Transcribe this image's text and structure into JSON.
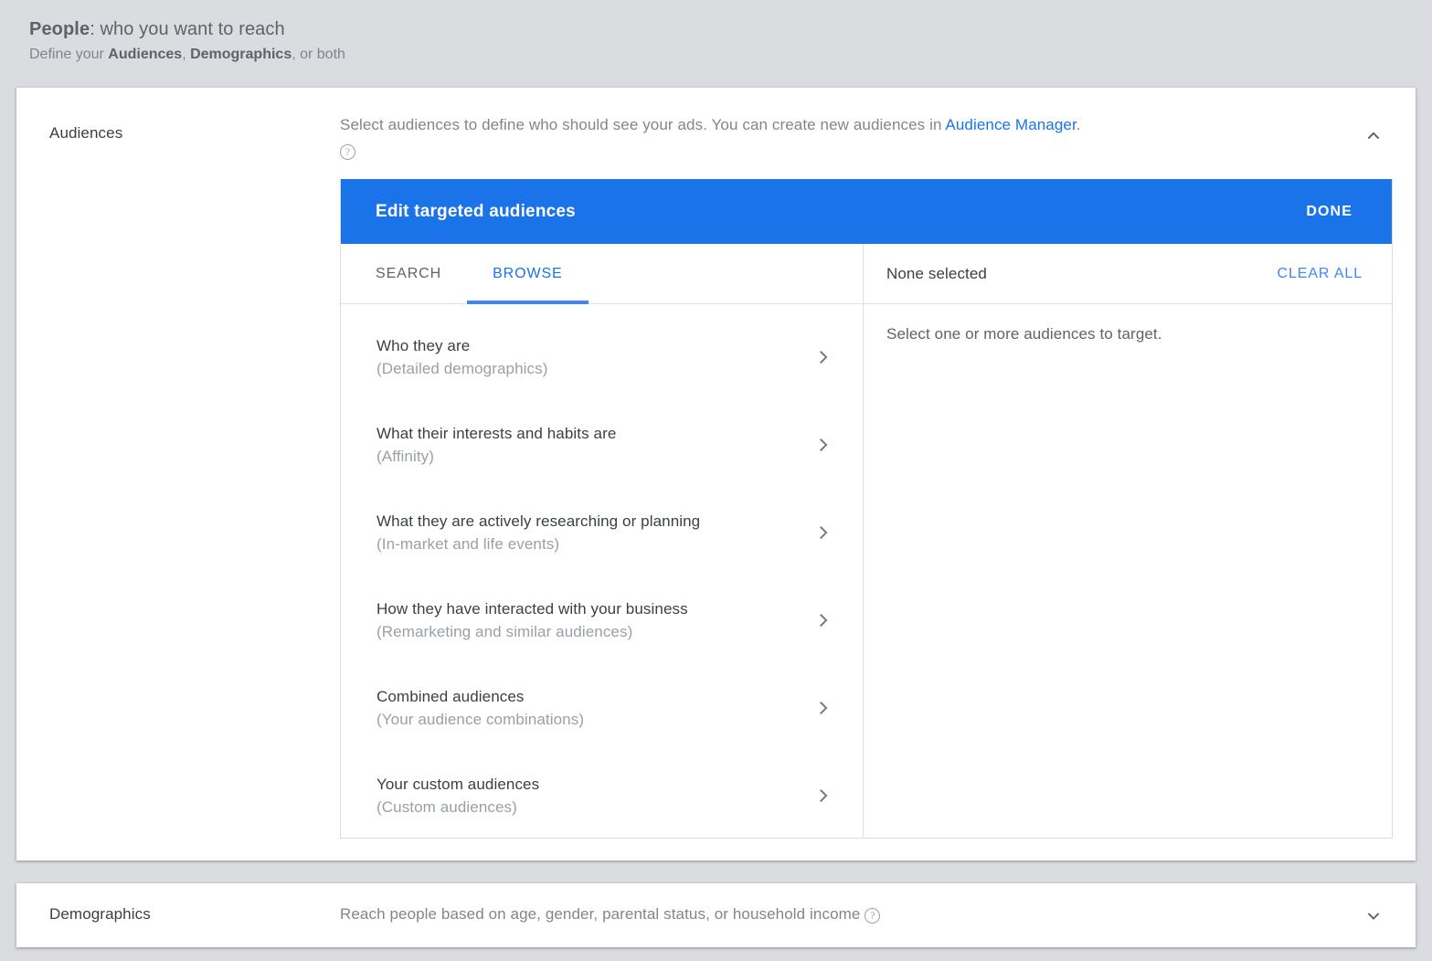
{
  "page": {
    "header": {
      "title_strong": "People",
      "title_rest": ": who you want to reach",
      "sub_lead": "Define your ",
      "sub_b1": "Audiences",
      "sub_mid": ", ",
      "sub_b2": "Demographics",
      "sub_tail": ", or both"
    }
  },
  "audiences": {
    "label": "Audiences",
    "description_pre": "Select audiences to define who should see your ads.  You can create new audiences in ",
    "description_link": "Audience Manager",
    "description_post": ".",
    "help_icon": "help-circle-icon",
    "collapse_icon": "chevron-up-icon",
    "dialog": {
      "title": "Edit targeted audiences",
      "done_label": "DONE",
      "tabs": [
        {
          "label": "SEARCH",
          "active": false
        },
        {
          "label": "BROWSE",
          "active": true
        }
      ],
      "selected_summary": "None selected",
      "clear_all_label": "CLEAR ALL",
      "empty_hint": "Select one or more audiences to target.",
      "browse_items": [
        {
          "title": "Who they are",
          "subtitle": "(Detailed demographics)",
          "arrow_icon": "chevron-right-icon"
        },
        {
          "title": "What their interests and habits are",
          "subtitle": "(Affinity)",
          "arrow_icon": "chevron-right-icon"
        },
        {
          "title": "What they are actively researching or planning",
          "subtitle": "(In-market and life events)",
          "arrow_icon": "chevron-right-icon"
        },
        {
          "title": "How they have interacted with your business",
          "subtitle": "(Remarketing and similar audiences)",
          "arrow_icon": "chevron-right-icon"
        },
        {
          "title": "Combined audiences",
          "subtitle": "(Your audience combinations)",
          "arrow_icon": "chevron-right-icon"
        },
        {
          "title": "Your custom audiences",
          "subtitle": "(Custom audiences)",
          "arrow_icon": "chevron-right-icon"
        }
      ]
    }
  },
  "demographics": {
    "label": "Demographics",
    "description": "Reach people based on age, gender, parental status, or household income",
    "help_icon": "help-circle-icon",
    "expand_icon": "chevron-down-icon"
  },
  "colors": {
    "accent_blue": "#1a73e8",
    "link_blue": "#4285f4",
    "page_background": "#dadce0",
    "card_background": "#ffffff",
    "text_primary": "#3c4043",
    "text_secondary": "#80868b",
    "text_muted": "#9aa0a6",
    "divider": "#e0e0e0"
  }
}
